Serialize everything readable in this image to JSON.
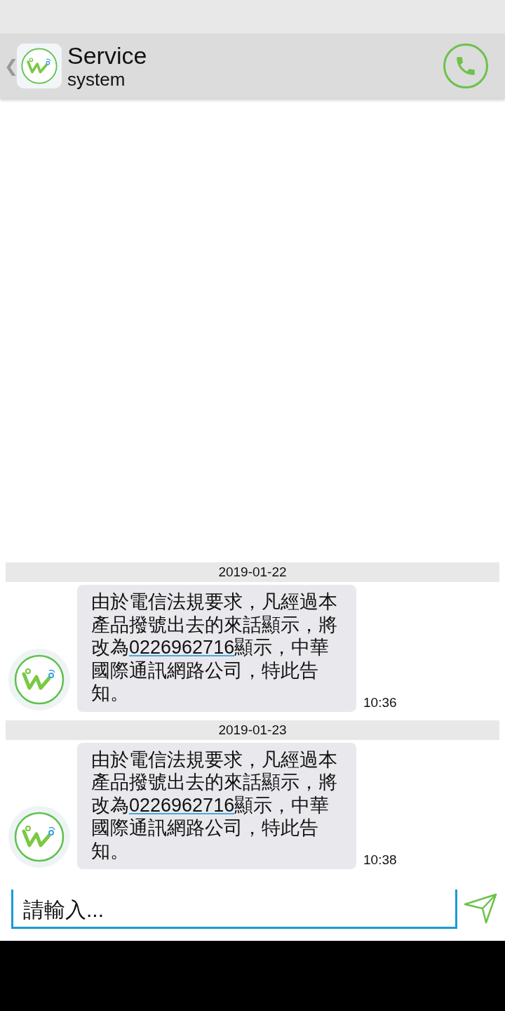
{
  "header": {
    "back": "❮",
    "title": "Service",
    "subtitle": "system"
  },
  "messages": [
    {
      "date": "2019-01-22",
      "text_before": "由於電信法規要求，凡經過本產品撥號出去的來話顯示，將改為",
      "link": "0226962716",
      "text_after": "顯示，中華國際通訊網路公司，特此告知。",
      "time": "10:36"
    },
    {
      "date": "2019-01-23",
      "text_before": "由於電信法規要求，凡經過本產品撥號出去的來話顯示，將改為",
      "link": "0226962716",
      "text_after": "顯示，中華國際通訊網路公司，特此告知。",
      "time": "10:38"
    }
  ],
  "composer": {
    "placeholder": "請輸入..."
  }
}
